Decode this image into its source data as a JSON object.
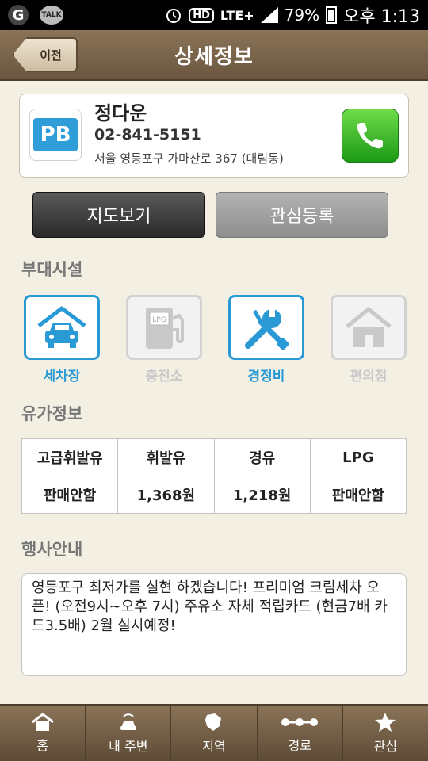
{
  "status_bar": {
    "talk_label": "TALK",
    "g_label": "G",
    "hd": "HD",
    "lte": "LTE+",
    "battery": "79%",
    "time": "오후 1:13"
  },
  "header": {
    "back_label": "이전",
    "title": "상세정보"
  },
  "station": {
    "logo": "PB",
    "name": "정다운",
    "phone": "02-841-5151",
    "address": "서울 영등포구 가마산로 367 (대림동)"
  },
  "actions": {
    "map_label": "지도보기",
    "favorite_label": "관심등록"
  },
  "facilities": {
    "title": "부대시설",
    "items": [
      {
        "label": "세차장",
        "enabled": true,
        "icon": "car-wash-icon"
      },
      {
        "label": "충전소",
        "enabled": false,
        "icon": "lpg-pump-icon"
      },
      {
        "label": "경정비",
        "enabled": true,
        "icon": "wrench-screwdriver-icon"
      },
      {
        "label": "편의점",
        "enabled": false,
        "icon": "house-icon"
      }
    ]
  },
  "fuel": {
    "title": "유가정보",
    "headers": [
      "고급휘발유",
      "휘발유",
      "경유",
      "LPG"
    ],
    "values": [
      "판매안함",
      "1,368원",
      "1,218원",
      "판매안함"
    ]
  },
  "event": {
    "title": "행사안내",
    "text": "영등포구 최저가를 실현 하겠습니다! 프리미엄 크림세차 오픈! (오전9시~오후 7시) 주유소 자체 적립카드 (현금7배 카드3.5배) 2월 실시예정!"
  },
  "tabs": [
    {
      "label": "홈",
      "icon": "home-icon"
    },
    {
      "label": "내 주변",
      "icon": "nearby-car-icon"
    },
    {
      "label": "지역",
      "icon": "region-map-icon"
    },
    {
      "label": "경로",
      "icon": "route-icon"
    },
    {
      "label": "관심",
      "icon": "star-icon"
    }
  ],
  "colors": {
    "accent": "#2a9ad6",
    "header_brown": "#7a6449",
    "call_green": "#2aa81e",
    "background": "#f3f0e3"
  }
}
